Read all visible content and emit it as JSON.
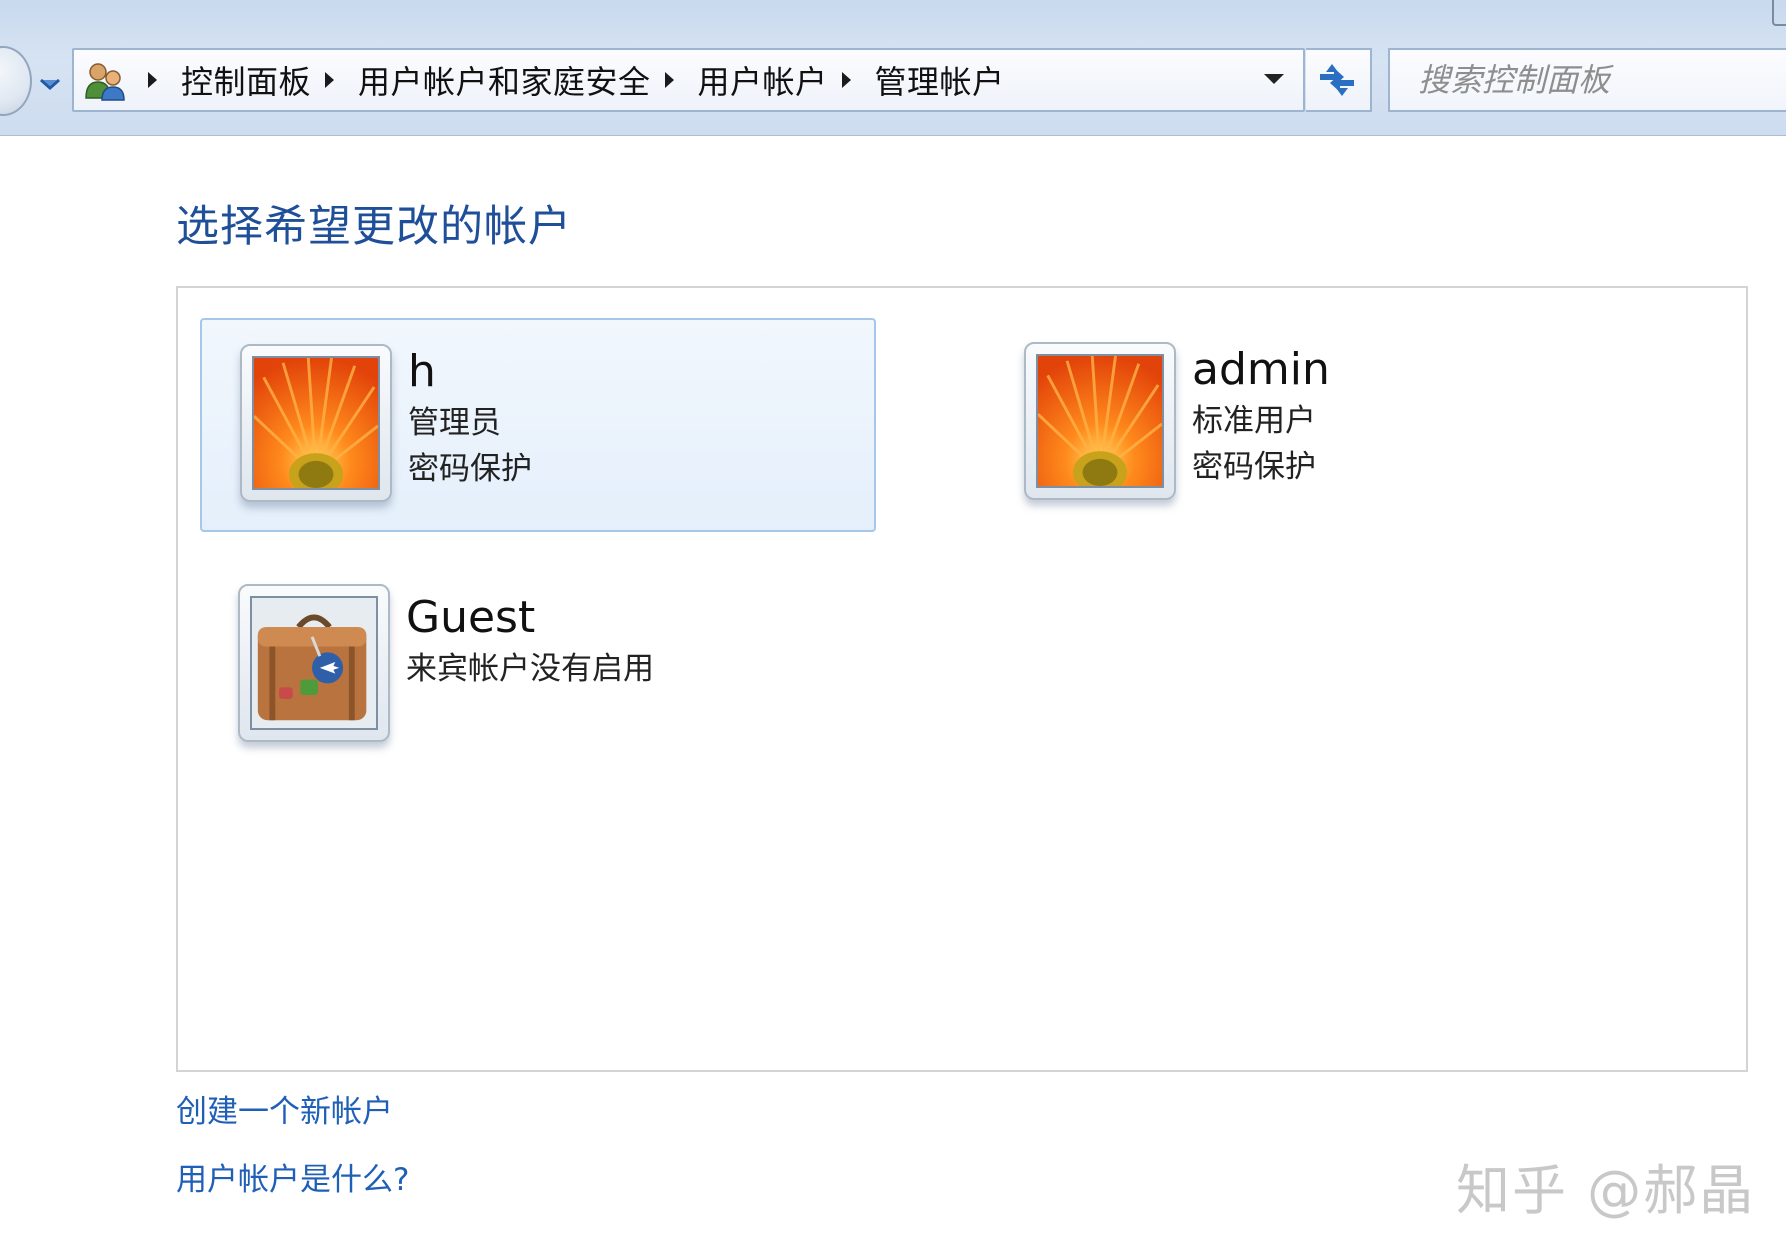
{
  "breadcrumb": {
    "items": [
      "控制面板",
      "用户帐户和家庭安全",
      "用户帐户",
      "管理帐户"
    ]
  },
  "search": {
    "placeholder": "搜索控制面板"
  },
  "main": {
    "title": "选择希望更改的帐户",
    "accounts": [
      {
        "name": "h",
        "lines": [
          "管理员",
          "密码保护"
        ],
        "picture": "orange-flower",
        "selected": true
      },
      {
        "name": "admin",
        "lines": [
          "标准用户",
          "密码保护"
        ],
        "picture": "orange-flower",
        "selected": false
      },
      {
        "name": "Guest",
        "lines": [
          "来宾帐户没有启用"
        ],
        "picture": "suitcase",
        "selected": false
      }
    ],
    "links": {
      "create_account": "创建一个新帐户",
      "what_is_account": "用户帐户是什么?"
    }
  },
  "watermark": "知乎 @郝晶",
  "icons": {
    "back": "back-arrow-icon",
    "history": "chevron-down-icon",
    "location": "users-icon",
    "address_dropdown": "chevron-down-icon",
    "refresh": "refresh-icon"
  },
  "colors": {
    "title": "#1e4f98",
    "link": "#1f60b6",
    "selection_border": "#a6c7ea",
    "selection_fill": "#e8f1fc",
    "navbar": "#d0def0"
  }
}
